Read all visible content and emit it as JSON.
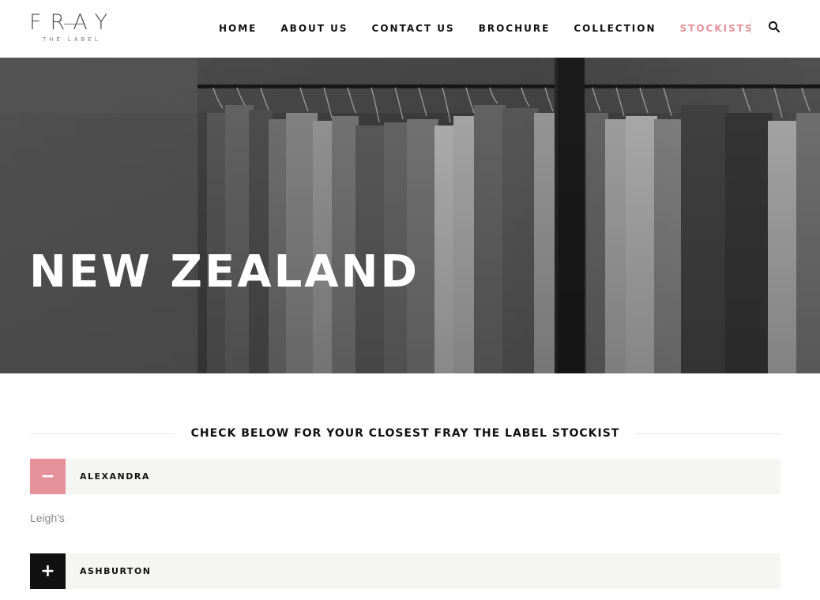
{
  "brand": {
    "logo_main": "FRAY",
    "logo_sub": "THE LABEL"
  },
  "nav": {
    "items": [
      {
        "label": "HOME",
        "active": false
      },
      {
        "label": "ABOUT US",
        "active": false
      },
      {
        "label": "CONTACT US",
        "active": false
      },
      {
        "label": "BROCHURE",
        "active": false
      },
      {
        "label": "COLLECTION",
        "active": false
      },
      {
        "label": "STOCKISTS",
        "active": true
      }
    ],
    "search_icon": "search-icon"
  },
  "hero": {
    "title": "NEW ZEALAND"
  },
  "content": {
    "heading": "CHECK BELOW FOR YOUR CLOSEST FRAY THE LABEL STOCKIST",
    "accordion": [
      {
        "label": "ALEXANDRA",
        "state": "open",
        "toggle_symbol": "−",
        "body": "Leigh's"
      },
      {
        "label": "ASHBURTON",
        "state": "closed",
        "toggle_symbol": "+"
      }
    ]
  },
  "colors": {
    "accent": "#e5929a",
    "dark": "#111111",
    "panel": "#f5f5f3"
  }
}
